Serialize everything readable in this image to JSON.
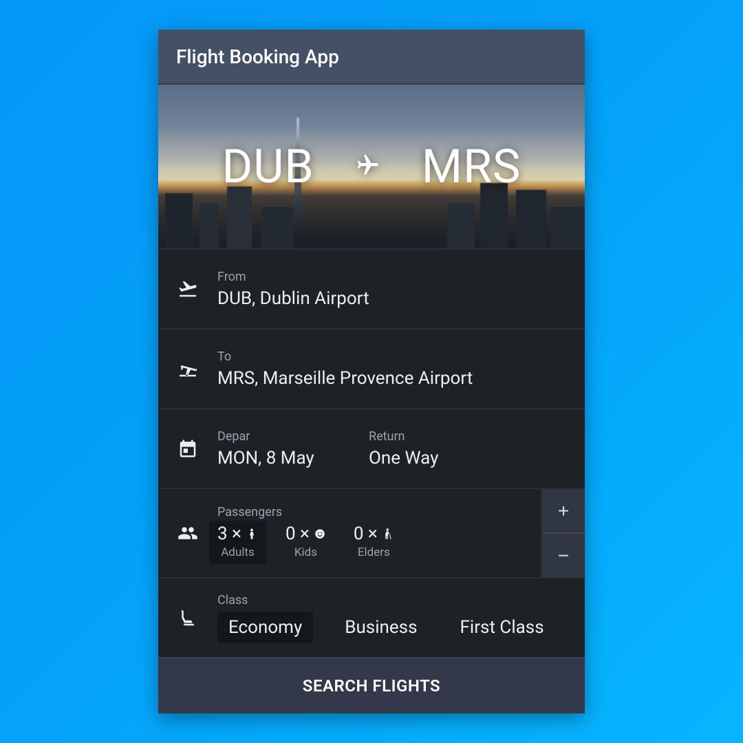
{
  "header": {
    "title": "Flight Booking App"
  },
  "route": {
    "from_code": "DUB",
    "to_code": "MRS"
  },
  "inputs": {
    "from": {
      "label": "From",
      "value": "DUB, Dublin Airport"
    },
    "to": {
      "label": "To",
      "value": "MRS, Marseille Provence Airport"
    }
  },
  "dates": {
    "depart": {
      "label": "Depar",
      "value": "MON, 8 May"
    },
    "return": {
      "label": "Return",
      "value": "One Way"
    }
  },
  "passengers": {
    "label": "Passengers",
    "adults": {
      "count": "3 ×",
      "sub": "Adults",
      "selected": true
    },
    "kids": {
      "count": "0 ×",
      "sub": "Kids",
      "selected": false
    },
    "elders": {
      "count": "0 ×",
      "sub": "Elders",
      "selected": false
    },
    "plus": "+",
    "minus": "−"
  },
  "travel_class": {
    "label": "Class",
    "options": [
      {
        "name": "Economy",
        "selected": true
      },
      {
        "name": "Business",
        "selected": false
      },
      {
        "name": "First Class",
        "selected": false
      }
    ]
  },
  "cta": {
    "search": "SEARCH FLIGHTS"
  }
}
